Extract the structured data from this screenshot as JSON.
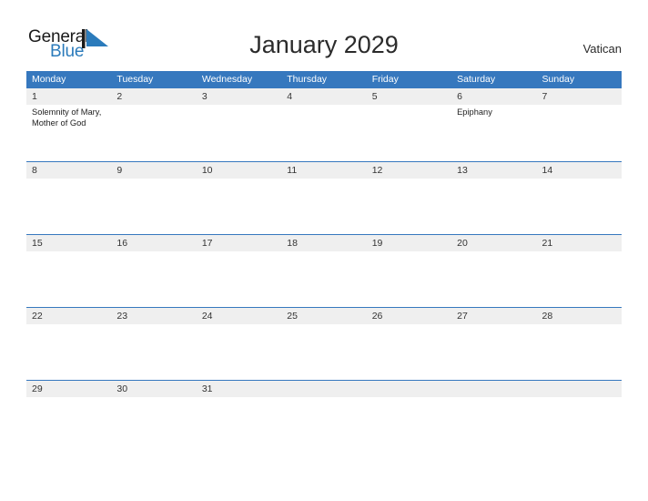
{
  "branding": {
    "logo_word_1": "General",
    "logo_word_2": "Blue",
    "logo_color_dark": "#1a1a1a",
    "logo_color_blue": "#2b7bbb",
    "flag_icon": "blue-triangle-flag-icon"
  },
  "header": {
    "title": "January 2029",
    "country": "Vatican"
  },
  "theme": {
    "header_blue": "#3678be",
    "band_gray": "#efefef",
    "text_dark": "#333333",
    "page_background": "#ffffff"
  },
  "calendar": {
    "weekdays": [
      "Monday",
      "Tuesday",
      "Wednesday",
      "Thursday",
      "Friday",
      "Saturday",
      "Sunday"
    ],
    "weeks": [
      {
        "days": [
          {
            "number": "1",
            "events": [
              "Solemnity of Mary,",
              "Mother of God"
            ]
          },
          {
            "number": "2",
            "events": []
          },
          {
            "number": "3",
            "events": []
          },
          {
            "number": "4",
            "events": []
          },
          {
            "number": "5",
            "events": []
          },
          {
            "number": "6",
            "events": [
              "Epiphany"
            ]
          },
          {
            "number": "7",
            "events": []
          }
        ]
      },
      {
        "days": [
          {
            "number": "8",
            "events": []
          },
          {
            "number": "9",
            "events": []
          },
          {
            "number": "10",
            "events": []
          },
          {
            "number": "11",
            "events": []
          },
          {
            "number": "12",
            "events": []
          },
          {
            "number": "13",
            "events": []
          },
          {
            "number": "14",
            "events": []
          }
        ]
      },
      {
        "days": [
          {
            "number": "15",
            "events": []
          },
          {
            "number": "16",
            "events": []
          },
          {
            "number": "17",
            "events": []
          },
          {
            "number": "18",
            "events": []
          },
          {
            "number": "19",
            "events": []
          },
          {
            "number": "20",
            "events": []
          },
          {
            "number": "21",
            "events": []
          }
        ]
      },
      {
        "days": [
          {
            "number": "22",
            "events": []
          },
          {
            "number": "23",
            "events": []
          },
          {
            "number": "24",
            "events": []
          },
          {
            "number": "25",
            "events": []
          },
          {
            "number": "26",
            "events": []
          },
          {
            "number": "27",
            "events": []
          },
          {
            "number": "28",
            "events": []
          }
        ]
      },
      {
        "days": [
          {
            "number": "29",
            "events": []
          },
          {
            "number": "30",
            "events": []
          },
          {
            "number": "31",
            "events": []
          },
          {
            "number": "",
            "events": []
          },
          {
            "number": "",
            "events": []
          },
          {
            "number": "",
            "events": []
          },
          {
            "number": "",
            "events": []
          }
        ]
      }
    ]
  }
}
